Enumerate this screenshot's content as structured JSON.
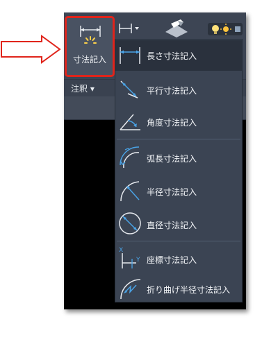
{
  "ribbon": {
    "dimension_button_label": "寸法記入",
    "annotation_panel_label": "注釈 ▾"
  },
  "menu": {
    "items": [
      {
        "label": "長さ寸法記入",
        "icon": "linear-dimension-icon"
      },
      {
        "label": "平行寸法記入",
        "icon": "aligned-dimension-icon"
      },
      {
        "label": "角度寸法記入",
        "icon": "angular-dimension-icon"
      },
      {
        "label": "弧長寸法記入",
        "icon": "arc-length-dimension-icon"
      },
      {
        "label": "半径寸法記入",
        "icon": "radius-dimension-icon"
      },
      {
        "label": "直径寸法記入",
        "icon": "diameter-dimension-icon"
      },
      {
        "label": "座標寸法記入",
        "icon": "ordinate-dimension-icon"
      },
      {
        "label": "折り曲げ半径寸法記入",
        "icon": "jogged-radius-dimension-icon"
      }
    ]
  },
  "colors": {
    "highlight_border": "#e0241b",
    "callout_arrow": "#e0241b",
    "ribbon_bg": "#3d4554",
    "menu_bg": "#3b4453",
    "icon_blue": "#4aa3e6"
  }
}
